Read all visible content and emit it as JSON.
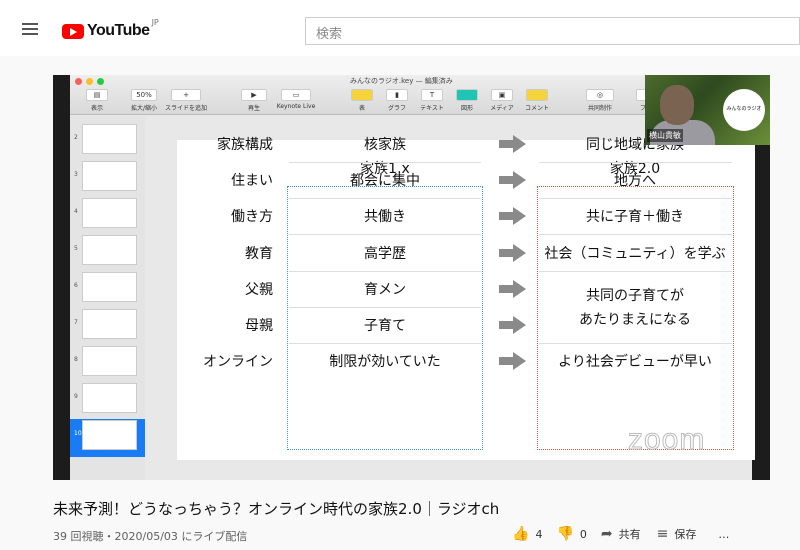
{
  "header": {
    "logo_text": "YouTube",
    "region": "JP",
    "search_placeholder": "検索"
  },
  "keynote": {
    "window_title": "みんなのラジオ.key — 編集済み",
    "toolbar": [
      {
        "label": "表示",
        "icon": "▤"
      },
      {
        "label": "拡大/縮小",
        "icon": "50%"
      },
      {
        "label": "スライドを追加",
        "icon": "+"
      },
      {
        "label": "再生",
        "icon": "▶"
      },
      {
        "label": "Keynote Live",
        "icon": "▭"
      },
      {
        "label": "表",
        "icon": ""
      },
      {
        "label": "グラフ",
        "icon": "▮"
      },
      {
        "label": "テキスト",
        "icon": "T"
      },
      {
        "label": "図形",
        "icon": ""
      },
      {
        "label": "メディア",
        "icon": "▣"
      },
      {
        "label": "コメント",
        "icon": ""
      },
      {
        "label": "共同制作",
        "icon": "◎"
      },
      {
        "label": "フォ",
        "icon": ""
      }
    ],
    "slide_numbers": [
      "2",
      "3",
      "4",
      "5",
      "6",
      "7",
      "8",
      "9",
      "10"
    ],
    "selected_slide": "10"
  },
  "slide": {
    "col1_header": "家族1.x",
    "col2_header": "家族2.0",
    "rows": [
      {
        "label": "家族構成",
        "v1": "核家族",
        "v2": "同じ地域に家族"
      },
      {
        "label": "住まい",
        "v1": "都会に集中",
        "v2": "地方へ"
      },
      {
        "label": "働き方",
        "v1": "共働き",
        "v2": "共に子育＋働き"
      },
      {
        "label": "教育",
        "v1": "高学歴",
        "v2": "社会（コミュニティ）を学ぶ"
      },
      {
        "label": "父親",
        "v1": "育メン",
        "v2": "共同の子育てが"
      },
      {
        "label": "母親",
        "v1": "子育て",
        "v2": "あたりまえになる"
      },
      {
        "label": "オンライン",
        "v1": "制限が効いていた",
        "v2": "より社会デビューが早い"
      }
    ],
    "colors": {
      "left_box": "#3a8fd8",
      "right_box": "#e0533a"
    }
  },
  "webcam": {
    "name": "横山貴敏",
    "logo_text": "みんなのラジオ"
  },
  "watermark": "zoom",
  "video_info": {
    "title": "未来予測！どうなっちゃう？オンライン時代の家族2.0｜ラジオch",
    "meta": "39 回視聴・2020/05/03 にライブ配信",
    "likes": "4",
    "dislikes": "0",
    "share": "共有",
    "save": "保存",
    "more": "…"
  }
}
